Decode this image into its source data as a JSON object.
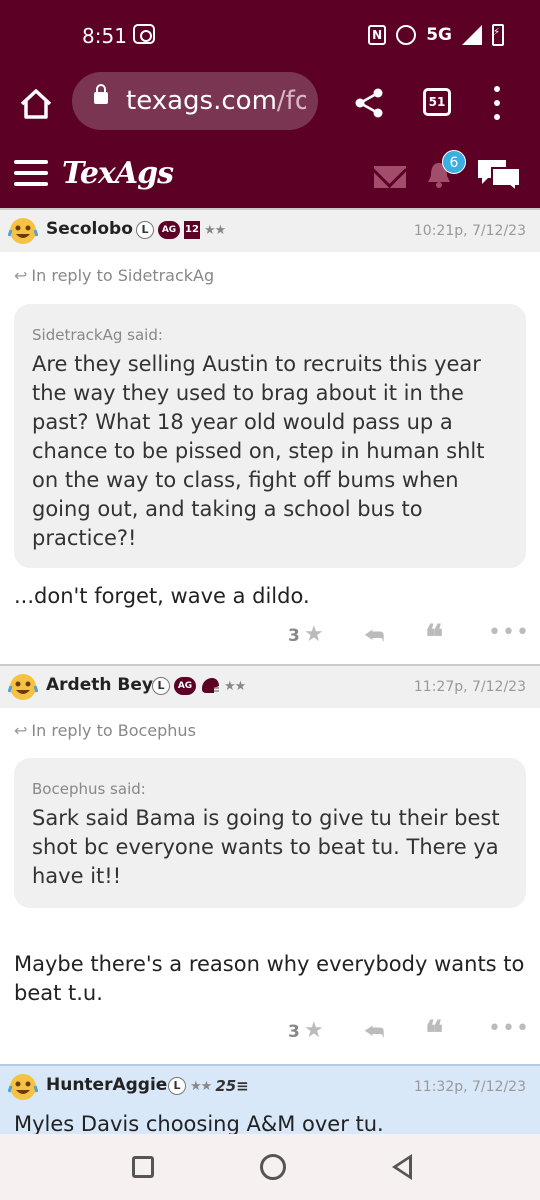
{
  "status_bar": {
    "time": "8:51",
    "network": "5G",
    "nfc_label": "N"
  },
  "browser": {
    "url_host": "texags.com",
    "url_path": "/fo",
    "tab_count": "51"
  },
  "site": {
    "logo": "TexAgs",
    "notification_count": "6"
  },
  "posts": [
    {
      "username": "Secolobo",
      "badges": [
        "L",
        "AG",
        "12"
      ],
      "stars": "★★",
      "time": "10:21p, 7/12/23",
      "reply_to": "In reply to SidetrackAg",
      "quote_author": "SidetrackAg said:",
      "quote_text": "Are they selling Austin to recruits this year the way they used to brag about it in the past? What 18 year old would pass up a chance to be pissed on, step in human shlt on the way to class, fight off bums when going out, and taking a school bus to practice?!",
      "body": "...don't forget, wave a dildo.",
      "star_count": "3"
    },
    {
      "username": "Ardeth Bey",
      "badges": [
        "L",
        "AG"
      ],
      "stars": "★★",
      "time": "11:27p, 7/12/23",
      "reply_to": "In reply to Bocephus",
      "quote_author": "Bocephus said:",
      "quote_text": "Sark said Bama is going to give tu their best shot bc everyone wants to beat tu. There ya have it!!",
      "body": "Maybe there's a reason why everybody wants to beat t.u.",
      "star_count": "3"
    },
    {
      "username": "HunterAggie",
      "badges": [
        "L"
      ],
      "stars": "★★",
      "extra_badge": "25≡",
      "time": "11:32p, 7/12/23",
      "body": "Myles Davis choosing A&M over tu."
    }
  ],
  "colors": {
    "maroon": "#5c0025",
    "badge_blue": "#3ab0e2"
  }
}
